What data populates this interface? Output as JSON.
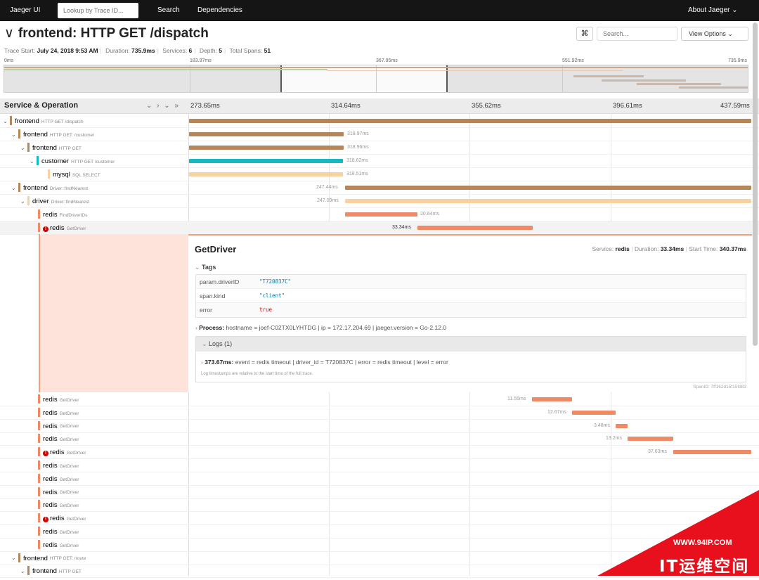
{
  "nav": {
    "brand": "Jaeger UI",
    "lookup_placeholder": "Lookup by Trace ID...",
    "search": "Search",
    "dependencies": "Dependencies",
    "about": "About Jaeger ⌄"
  },
  "header": {
    "title": "frontend: HTTP GET /dispatch",
    "cmd": "⌘",
    "search_placeholder": "Search...",
    "view_options": "View Options ⌄"
  },
  "meta": {
    "start_label": "Trace Start:",
    "start": "July 24, 2018 9:53 AM",
    "duration_label": "Duration:",
    "duration": "735.9ms",
    "services_label": "Services:",
    "services": "6",
    "depth_label": "Depth:",
    "depth": "5",
    "spans_label": "Total Spans:",
    "spans": "51"
  },
  "minimap": {
    "labels": [
      "0ms",
      "183.97ms",
      "367.95ms",
      "551.92ms",
      "735.9ms"
    ]
  },
  "columns": {
    "service_op": "Service & Operation",
    "controls": "⌄ › ⌄ »",
    "ticks": [
      "273.65ms",
      "314.64ms",
      "355.62ms",
      "396.61ms",
      "437.59ms"
    ]
  },
  "colors": {
    "frontend": "#b5865a",
    "customer": "#17b8be",
    "mysql": "#f8d29e",
    "driver": "#f8d29e",
    "redis": "#f08a66"
  },
  "rows_top": [
    {
      "svc": "frontend",
      "op": "HTTP GET /dispatch",
      "label": ""
    },
    {
      "svc": "frontend",
      "op": "HTTP GET: /customer",
      "label": "318.97ms"
    },
    {
      "svc": "frontend",
      "op": "HTTP GET",
      "label": "318.96ms"
    },
    {
      "svc": "customer",
      "op": "HTTP GET /customer",
      "label": "318.62ms"
    },
    {
      "svc": "mysql",
      "op": "SQL SELECT",
      "label": "318.51ms"
    },
    {
      "svc": "frontend",
      "op": "Driver::findNearest",
      "label": "247.44ms"
    },
    {
      "svc": "driver",
      "op": "Driver::findNearest",
      "label": "247.09ms"
    },
    {
      "svc": "redis",
      "op": "FindDriverIDs",
      "label": "20.84ms"
    },
    {
      "svc": "redis",
      "op": "GetDriver",
      "label": "33.34ms"
    }
  ],
  "detail": {
    "title": "GetDriver",
    "service_label": "Service:",
    "service": "redis",
    "duration_label": "Duration:",
    "duration": "33.34ms",
    "start_label": "Start Time:",
    "start": "340.37ms",
    "tags_header": "Tags",
    "tags": [
      {
        "k": "param.driverID",
        "v": "\"T720837C\""
      },
      {
        "k": "span.kind",
        "v": "\"client\""
      },
      {
        "k": "error",
        "v": "true"
      }
    ],
    "process_label": "Process:",
    "process": "hostname = joef-C02TX0LYHTDG   |   ip = 172.17.204.69   |   jaeger.version = Go-2.12.0",
    "logs_header": "Logs (1)",
    "log_time": "373.67ms:",
    "log_fields": "event = redis timeout   |   driver_id = T720837C   |   error = redis timeout   |   level = error",
    "log_note": "Log timestamps are relative to the start time of the full trace.",
    "span_id": "SpanID: 7ff162d15f15fd83"
  },
  "rows_bottom": [
    {
      "svc": "redis",
      "op": "GetDriver",
      "label": "11.55ms",
      "err": false
    },
    {
      "svc": "redis",
      "op": "GetDriver",
      "label": "12.67ms",
      "err": false
    },
    {
      "svc": "redis",
      "op": "GetDriver",
      "label": "3.48ms",
      "err": false
    },
    {
      "svc": "redis",
      "op": "GetDriver",
      "label": "13.2ms",
      "err": false
    },
    {
      "svc": "redis",
      "op": "GetDriver",
      "label": "37.63ms",
      "err": true
    },
    {
      "svc": "redis",
      "op": "GetDriver",
      "label": "",
      "err": false
    },
    {
      "svc": "redis",
      "op": "GetDriver",
      "label": "",
      "err": false
    },
    {
      "svc": "redis",
      "op": "GetDriver",
      "label": "",
      "err": false
    },
    {
      "svc": "redis",
      "op": "GetDriver",
      "label": "",
      "err": false
    },
    {
      "svc": "redis",
      "op": "GetDriver",
      "label": "",
      "err": true
    },
    {
      "svc": "redis",
      "op": "GetDriver",
      "label": "",
      "err": false
    },
    {
      "svc": "redis",
      "op": "GetDriver",
      "label": "",
      "err": false
    },
    {
      "svc": "frontend",
      "op": "HTTP GET: /route",
      "label": "",
      "err": false
    },
    {
      "svc": "frontend",
      "op": "HTTP GET",
      "label": "",
      "err": false
    }
  ],
  "watermark": {
    "url": "WWW.94IP.COM",
    "name": "IT运维空间"
  }
}
